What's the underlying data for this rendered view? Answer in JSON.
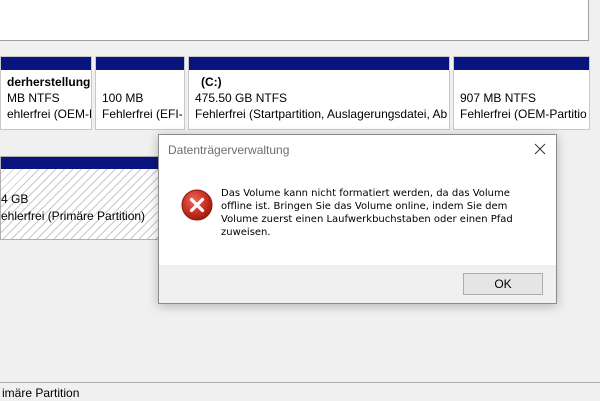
{
  "partitions": [
    {
      "name": "derherstellung",
      "size": "MB NTFS",
      "status": "ehlerfrei (OEM-Part"
    },
    {
      "name": "",
      "size": "100 MB",
      "status": "Fehlerfrei (EFI-"
    },
    {
      "name": "(C:)",
      "size": "475.50 GB NTFS",
      "status": "Fehlerfrei (Startpartition, Auslagerungsdatei, Ab"
    },
    {
      "name": "",
      "size": "907 MB NTFS",
      "status": "Fehlerfrei (OEM-Partitio"
    }
  ],
  "disk2": {
    "size": "4 GB",
    "status": "ehlerfrei (Primäre Partition)"
  },
  "legend": {
    "label": "imäre Partition"
  },
  "dialog": {
    "title": "Datenträgerverwaltung",
    "message_lines": [
      "Das Volume kann nicht formatiert werden, da das Volume",
      "offline ist. Bringen Sie das Volume online, indem Sie dem",
      "Volume zuerst einen Laufwerkbuchstaben oder einen Pfad",
      "zuweisen."
    ],
    "ok_label": "OK",
    "icon": "error-icon",
    "accent": "#c42b1c"
  },
  "colors": {
    "partition_bar": "#0a147e"
  }
}
